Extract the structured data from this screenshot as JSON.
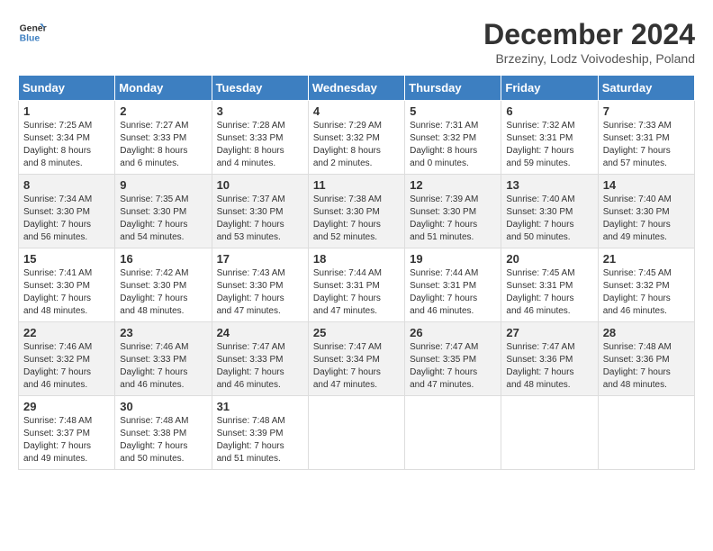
{
  "header": {
    "logo_line1": "General",
    "logo_line2": "Blue",
    "title": "December 2024",
    "subtitle": "Brzeziny, Lodz Voivodeship, Poland"
  },
  "calendar": {
    "weekdays": [
      "Sunday",
      "Monday",
      "Tuesday",
      "Wednesday",
      "Thursday",
      "Friday",
      "Saturday"
    ],
    "weeks": [
      [
        {
          "day": "1",
          "info": "Sunrise: 7:25 AM\nSunset: 3:34 PM\nDaylight: 8 hours\nand 8 minutes."
        },
        {
          "day": "2",
          "info": "Sunrise: 7:27 AM\nSunset: 3:33 PM\nDaylight: 8 hours\nand 6 minutes."
        },
        {
          "day": "3",
          "info": "Sunrise: 7:28 AM\nSunset: 3:33 PM\nDaylight: 8 hours\nand 4 minutes."
        },
        {
          "day": "4",
          "info": "Sunrise: 7:29 AM\nSunset: 3:32 PM\nDaylight: 8 hours\nand 2 minutes."
        },
        {
          "day": "5",
          "info": "Sunrise: 7:31 AM\nSunset: 3:32 PM\nDaylight: 8 hours\nand 0 minutes."
        },
        {
          "day": "6",
          "info": "Sunrise: 7:32 AM\nSunset: 3:31 PM\nDaylight: 7 hours\nand 59 minutes."
        },
        {
          "day": "7",
          "info": "Sunrise: 7:33 AM\nSunset: 3:31 PM\nDaylight: 7 hours\nand 57 minutes."
        }
      ],
      [
        {
          "day": "8",
          "info": "Sunrise: 7:34 AM\nSunset: 3:30 PM\nDaylight: 7 hours\nand 56 minutes."
        },
        {
          "day": "9",
          "info": "Sunrise: 7:35 AM\nSunset: 3:30 PM\nDaylight: 7 hours\nand 54 minutes."
        },
        {
          "day": "10",
          "info": "Sunrise: 7:37 AM\nSunset: 3:30 PM\nDaylight: 7 hours\nand 53 minutes."
        },
        {
          "day": "11",
          "info": "Sunrise: 7:38 AM\nSunset: 3:30 PM\nDaylight: 7 hours\nand 52 minutes."
        },
        {
          "day": "12",
          "info": "Sunrise: 7:39 AM\nSunset: 3:30 PM\nDaylight: 7 hours\nand 51 minutes."
        },
        {
          "day": "13",
          "info": "Sunrise: 7:40 AM\nSunset: 3:30 PM\nDaylight: 7 hours\nand 50 minutes."
        },
        {
          "day": "14",
          "info": "Sunrise: 7:40 AM\nSunset: 3:30 PM\nDaylight: 7 hours\nand 49 minutes."
        }
      ],
      [
        {
          "day": "15",
          "info": "Sunrise: 7:41 AM\nSunset: 3:30 PM\nDaylight: 7 hours\nand 48 minutes."
        },
        {
          "day": "16",
          "info": "Sunrise: 7:42 AM\nSunset: 3:30 PM\nDaylight: 7 hours\nand 48 minutes."
        },
        {
          "day": "17",
          "info": "Sunrise: 7:43 AM\nSunset: 3:30 PM\nDaylight: 7 hours\nand 47 minutes."
        },
        {
          "day": "18",
          "info": "Sunrise: 7:44 AM\nSunset: 3:31 PM\nDaylight: 7 hours\nand 47 minutes."
        },
        {
          "day": "19",
          "info": "Sunrise: 7:44 AM\nSunset: 3:31 PM\nDaylight: 7 hours\nand 46 minutes."
        },
        {
          "day": "20",
          "info": "Sunrise: 7:45 AM\nSunset: 3:31 PM\nDaylight: 7 hours\nand 46 minutes."
        },
        {
          "day": "21",
          "info": "Sunrise: 7:45 AM\nSunset: 3:32 PM\nDaylight: 7 hours\nand 46 minutes."
        }
      ],
      [
        {
          "day": "22",
          "info": "Sunrise: 7:46 AM\nSunset: 3:32 PM\nDaylight: 7 hours\nand 46 minutes."
        },
        {
          "day": "23",
          "info": "Sunrise: 7:46 AM\nSunset: 3:33 PM\nDaylight: 7 hours\nand 46 minutes."
        },
        {
          "day": "24",
          "info": "Sunrise: 7:47 AM\nSunset: 3:33 PM\nDaylight: 7 hours\nand 46 minutes."
        },
        {
          "day": "25",
          "info": "Sunrise: 7:47 AM\nSunset: 3:34 PM\nDaylight: 7 hours\nand 47 minutes."
        },
        {
          "day": "26",
          "info": "Sunrise: 7:47 AM\nSunset: 3:35 PM\nDaylight: 7 hours\nand 47 minutes."
        },
        {
          "day": "27",
          "info": "Sunrise: 7:47 AM\nSunset: 3:36 PM\nDaylight: 7 hours\nand 48 minutes."
        },
        {
          "day": "28",
          "info": "Sunrise: 7:48 AM\nSunset: 3:36 PM\nDaylight: 7 hours\nand 48 minutes."
        }
      ],
      [
        {
          "day": "29",
          "info": "Sunrise: 7:48 AM\nSunset: 3:37 PM\nDaylight: 7 hours\nand 49 minutes."
        },
        {
          "day": "30",
          "info": "Sunrise: 7:48 AM\nSunset: 3:38 PM\nDaylight: 7 hours\nand 50 minutes."
        },
        {
          "day": "31",
          "info": "Sunrise: 7:48 AM\nSunset: 3:39 PM\nDaylight: 7 hours\nand 51 minutes."
        },
        {
          "day": "",
          "info": ""
        },
        {
          "day": "",
          "info": ""
        },
        {
          "day": "",
          "info": ""
        },
        {
          "day": "",
          "info": ""
        }
      ]
    ]
  }
}
